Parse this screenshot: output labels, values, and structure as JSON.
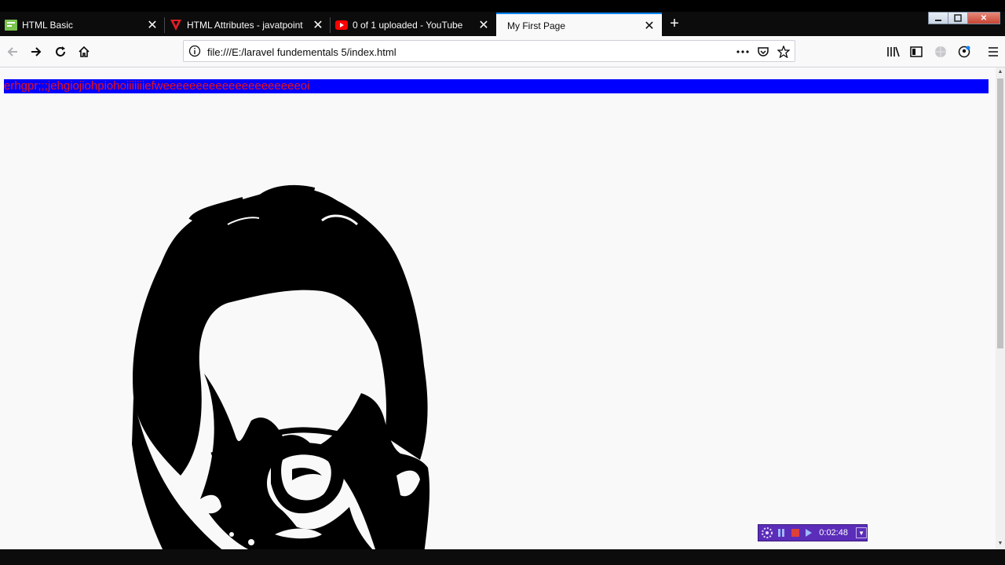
{
  "browser": {
    "tabs": [
      {
        "label": "HTML Basic",
        "icon": "html-basic-favicon",
        "active": false
      },
      {
        "label": "HTML Attributes - javatpoint",
        "icon": "javatpoint-favicon",
        "active": false
      },
      {
        "label": "0 of 1 uploaded - YouTube",
        "icon": "youtube-favicon",
        "active": false
      },
      {
        "label": "My First Page",
        "icon": "",
        "active": true
      }
    ],
    "new_tab_icon": "plus-icon",
    "close_icon": "close-icon",
    "address": {
      "url": "file:///E:/laravel fundementals 5/index.html",
      "info_icon": "info-icon",
      "page_actions": [
        "more-actions-icon",
        "pocket-icon",
        "bookmark-star-icon"
      ]
    },
    "nav": [
      "back-arrow-icon",
      "forward-arrow-icon",
      "reload-icon",
      "home-icon"
    ],
    "toolbar_right": [
      "library-icon",
      "sidebar-icon",
      "extension-icon",
      "account-icon",
      "menu-icon"
    ],
    "window_controls": [
      "minimize",
      "restore",
      "close"
    ]
  },
  "page": {
    "heading_text": "erhgpr;;;jehgiojiohpiohoiiiiiiiefweeeeeeeeeeeeeeeeeeeeeoi",
    "heading_bg": "#0000ff",
    "heading_color": "#e8101e",
    "image": "stylized-black-portrait-of-man-with-glasses"
  },
  "recorder": {
    "time": "0:02:48",
    "accent": "#5b2db8",
    "buttons": [
      "pause-icon",
      "stop-icon",
      "play-icon"
    ]
  }
}
